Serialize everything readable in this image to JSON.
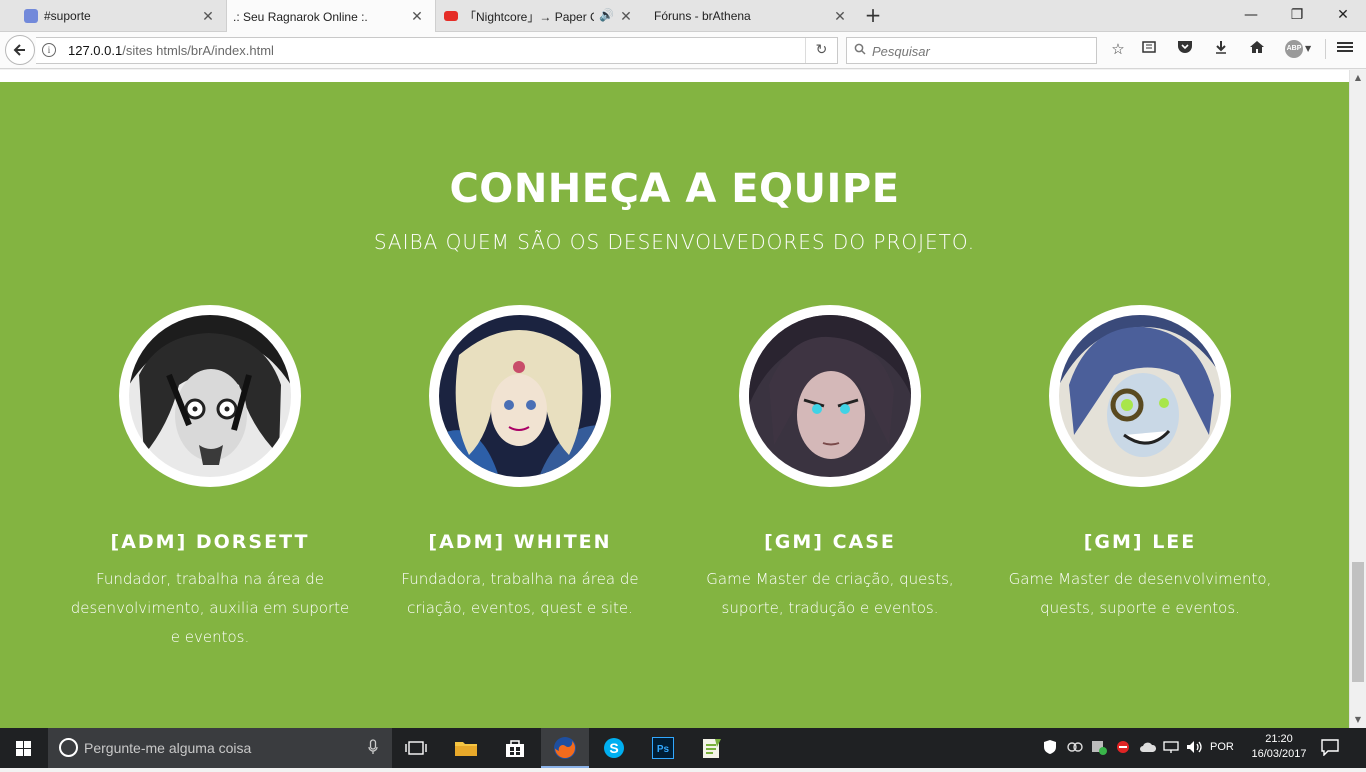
{
  "browser": {
    "tabs": [
      {
        "label": "#suporte",
        "icon": "discord-icon",
        "color": "#7289da"
      },
      {
        "label": ".: Seu Ragnarok Online :.",
        "active": true
      },
      {
        "label": "「Nightcore」→ Paper C...",
        "icon": "youtube-icon",
        "color": "#e52d27"
      },
      {
        "label": "Fóruns - brAthena"
      }
    ],
    "address": {
      "host": "127.0.0.1",
      "path": "/sites htmls/brA/index.html"
    },
    "search_placeholder": "Pesquisar",
    "abp_label": "ABP"
  },
  "team": {
    "title": "CONHEÇA A EQUIPE",
    "subtitle": "SAIBA QUEM SÃO OS DESENVOLVEDORES DO PROJETO.",
    "bg_color": "#83b441",
    "members": [
      {
        "name": "[ADM] DORSETT",
        "description": "Fundador, trabalha na área de desenvolvimento, auxilia em suporte e eventos."
      },
      {
        "name": "[ADM] WHITEN",
        "description": "Fundadora, trabalha na área de criação, eventos, quest e site."
      },
      {
        "name": "[GM] CASE",
        "description": "Game Master de criação, quests, suporte, tradução e eventos."
      },
      {
        "name": "[GM] LEE",
        "description": "Game Master de desenvolvimento, quests, suporte e eventos."
      }
    ]
  },
  "taskbar": {
    "search_placeholder": "Pergunte-me alguma coisa",
    "language": "POR",
    "time": "21:20",
    "date": "16/03/2017"
  }
}
